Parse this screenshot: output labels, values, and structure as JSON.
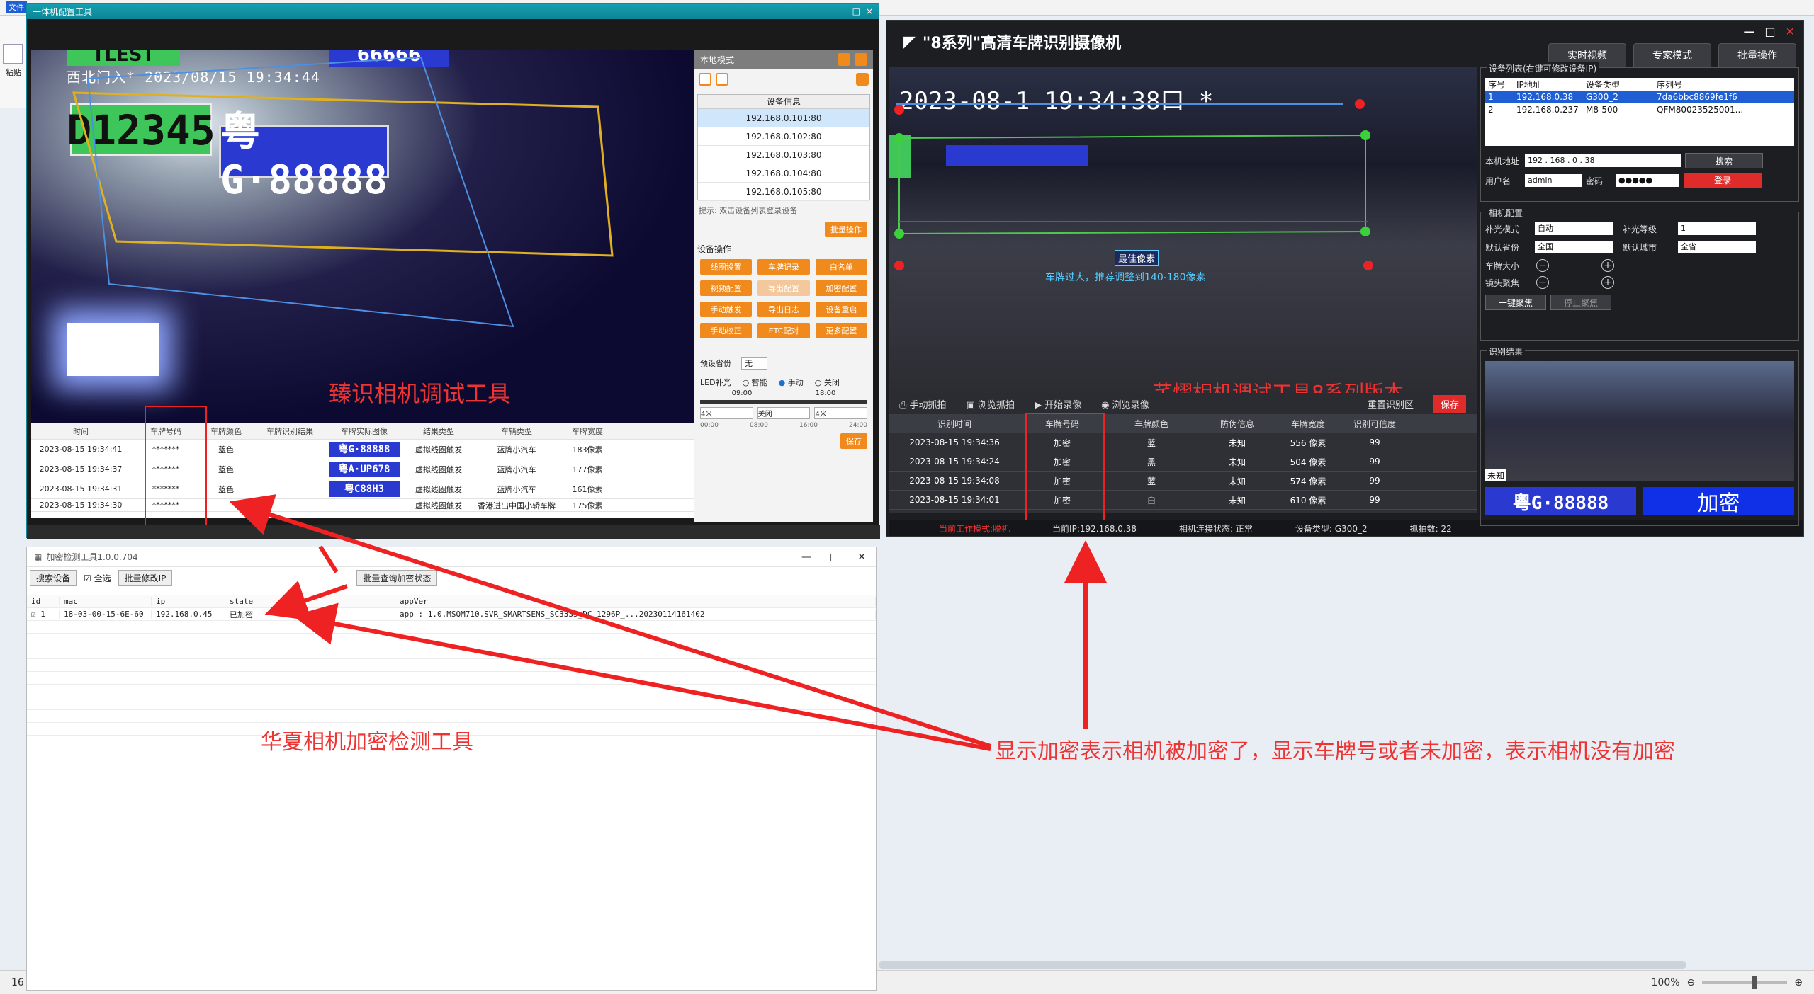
{
  "bg": {
    "menu_file": "文件",
    "ribbon_paste": "粘贴",
    "status_left": "16",
    "zoom": "100%"
  },
  "w1": {
    "title": "一体机配置工具",
    "osd": "西北门入* 2023/08/15 19:34:44",
    "plate_green": "D12345",
    "plate_blue": "粤G·88888",
    "plate_top": "TLEST",
    "plate_top2": "66666",
    "overlay_label": "臻识相机调试工具",
    "side": {
      "mode": "本地模式",
      "list_header": "设备信息",
      "devices": [
        "192.168.0.101:80",
        "192.168.0.102:80",
        "192.168.0.103:80",
        "192.168.0.104:80",
        "192.168.0.105:80"
      ],
      "hint": "提示: 双击设备列表登录设备",
      "batch_btn": "批量操作",
      "ops_title": "设备操作",
      "ops": [
        "线圈设置",
        "车牌记录",
        "白名单",
        "视频配置",
        "导出配置",
        "加密配置",
        "手动触发",
        "导出日志",
        "设备重启",
        "手动校正",
        "ETC配对",
        "更多配置"
      ],
      "preset_label": "预设省份",
      "preset_value": "无",
      "led_label": "LED补光",
      "led_opts": [
        "智能",
        "手动",
        "关闭"
      ],
      "times": [
        "09:00",
        "18:00"
      ],
      "sel": [
        "4米",
        "关闭",
        "4米"
      ],
      "ticks": [
        "00:00",
        "08:00",
        "16:00",
        "24:00"
      ],
      "save": "保存"
    },
    "table": {
      "headers": [
        "时间",
        "车牌号码",
        "车牌颜色",
        "车牌识别结果",
        "车牌实际图像",
        "结果类型",
        "车辆类型",
        "车牌宽度"
      ],
      "rows": [
        [
          "2023-08-15 19:34:41",
          "*******",
          "蓝色",
          "",
          "粤G·88888",
          "虚拟线圈触发",
          "蓝牌小汽车",
          "183像素"
        ],
        [
          "2023-08-15 19:34:37",
          "*******",
          "蓝色",
          "",
          "粤A·UP678",
          "虚拟线圈触发",
          "蓝牌小汽车",
          "177像素"
        ],
        [
          "2023-08-15 19:34:31",
          "*******",
          "蓝色",
          "",
          "粤C88H3",
          "虚拟线圈触发",
          "蓝牌小汽车",
          "161像素"
        ],
        [
          "2023-08-15 19:34:30",
          "*******",
          "",
          "",
          "",
          "虚拟线圈触发",
          "香港进出中国小轿车牌",
          "175像素"
        ]
      ]
    }
  },
  "w2": {
    "title": "\"8系列\"高清车牌识别摄像机",
    "tabs": [
      "实时视频",
      "专家模式",
      "批量操作"
    ],
    "osd": "2023-08-1  19:34:38口 *",
    "best_px": "最佳像素",
    "warn_px": "车牌过大，推荐调整到140-180像素",
    "overlay_label": "芊熠相机调试工具8系列版本",
    "toolbar": [
      "手动抓拍",
      "浏览抓拍",
      "开始录像",
      "浏览录像"
    ],
    "reset_area": "重置识别区",
    "save": "保存",
    "table": {
      "headers": [
        "识别时间",
        "车牌号码",
        "车牌颜色",
        "防伪信息",
        "车牌宽度",
        "识别可信度"
      ],
      "rows": [
        [
          "2023-08-15 19:34:36",
          "加密",
          "蓝",
          "未知",
          "556 像素",
          "99"
        ],
        [
          "2023-08-15 19:34:24",
          "加密",
          "黑",
          "未知",
          "504 像素",
          "99"
        ],
        [
          "2023-08-15 19:34:08",
          "加密",
          "蓝",
          "未知",
          "574 像素",
          "99"
        ],
        [
          "2023-08-15 19:34:01",
          "加密",
          "白",
          "未知",
          "610 像素",
          "99"
        ]
      ]
    },
    "status": [
      "当前工作模式:脱机",
      "当前IP:192.168.0.38",
      "相机连接状态: 正常",
      "设备类型: G300_2",
      "抓拍数: 22"
    ],
    "right": {
      "devlist_title": "设备列表(右键可修改设备IP)",
      "devlist_headers": [
        "序号",
        "IP地址",
        "设备类型",
        "序列号"
      ],
      "devlist_rows": [
        [
          "1",
          "192.168.0.38",
          "G300_2",
          "7da6bbc8869fe1f6"
        ],
        [
          "2",
          "192.168.0.237",
          "M8-500",
          "QFM80023525001..."
        ]
      ],
      "local_ip_label": "本机地址",
      "local_ip": "192 . 168 . 0 . 38",
      "search": "搜索",
      "user_label": "用户名",
      "user": "admin",
      "pwd_label": "密码",
      "pwd": "●●●●●",
      "login": "登录",
      "cfg_title": "相机配置",
      "fill_mode_label": "补光模式",
      "fill_mode": "自动",
      "fill_level_label": "补光等级",
      "fill_level": "1",
      "prov_label": "默认省份",
      "prov": "全国",
      "city_label": "默认城市",
      "city": "全省",
      "plate_size_label": "车牌大小",
      "focus_label": "镜头聚焦",
      "one_key_focus": "一键聚焦",
      "stop_focus": "停止聚焦",
      "result_title": "识别结果",
      "result_tag": "未知",
      "result_plate": "粤G·88888",
      "result_enc": "加密"
    }
  },
  "w3": {
    "title": "加密检测工具1.0.0.704",
    "search_btn": "搜索设备",
    "select_all": "全选",
    "batch_ip": "批量修改IP",
    "batch_query": "批量查询加密状态",
    "headers": [
      "id",
      "mac",
      "ip",
      "state",
      "appVer"
    ],
    "rows": [
      [
        "1",
        "18-03-00-15-6E-60",
        "192.168.0.45",
        "已加密",
        "app : 1.0.MSQM710.SVR_SMARTSENS_SC3335_DC_1296P_...20230114161402"
      ]
    ],
    "overlay_label": "华夏相机加密检测工具"
  },
  "annotation": "显示加密表示相机被加密了，显示车牌号或者未加密，表示相机没有加密"
}
